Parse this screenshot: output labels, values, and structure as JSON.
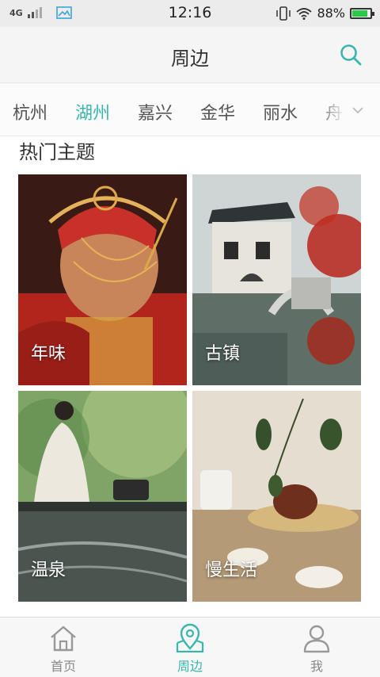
{
  "status_bar": {
    "network": "4G",
    "time": "12:16",
    "battery_percent": "88%",
    "battery_level": 0.88,
    "icons": [
      "signal-icon",
      "image-icon",
      "vibrate-icon",
      "wifi-icon",
      "battery-icon"
    ]
  },
  "header": {
    "title": "周边",
    "search_icon": "search-icon"
  },
  "city_tabs": {
    "items": [
      "杭州",
      "湖州",
      "嘉兴",
      "金华",
      "丽水",
      "舟山"
    ],
    "active": "湖州",
    "expand_icon": "chevron-down-icon"
  },
  "section": {
    "title": "热门主题"
  },
  "themes": [
    {
      "label": "年味"
    },
    {
      "label": "古镇"
    },
    {
      "label": "温泉"
    },
    {
      "label": "慢生活"
    }
  ],
  "bottom_nav": {
    "items": [
      {
        "label": "首页",
        "icon": "home-icon"
      },
      {
        "label": "周边",
        "icon": "map-pin-icon"
      },
      {
        "label": "我",
        "icon": "user-icon"
      }
    ],
    "active": "周边"
  },
  "colors": {
    "accent": "#3cb5ac",
    "battery": "#2cc84a"
  }
}
